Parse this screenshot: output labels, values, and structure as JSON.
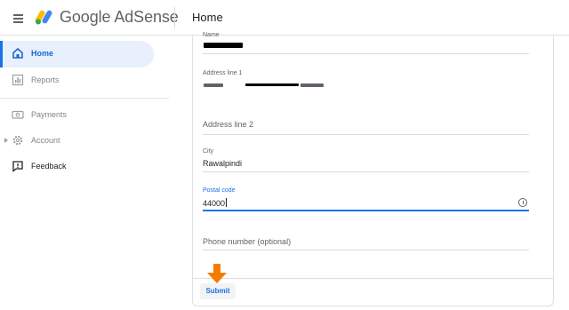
{
  "app": {
    "brand": "Google AdSense",
    "page_title": "Home"
  },
  "sidebar": {
    "items": [
      {
        "label": "Home",
        "icon": "home-icon",
        "active": true
      },
      {
        "label": "Reports",
        "icon": "reports-icon"
      },
      {
        "label": "Payments",
        "icon": "payments-icon"
      },
      {
        "label": "Account",
        "icon": "gear-icon"
      },
      {
        "label": "Feedback",
        "icon": "feedback-icon"
      }
    ]
  },
  "form": {
    "name": {
      "label": "Name",
      "value": ""
    },
    "address1": {
      "label": "Address line 1",
      "value": ""
    },
    "address2": {
      "placeholder": "Address line 2"
    },
    "city": {
      "label": "City",
      "value": "Rawalpindi"
    },
    "postal": {
      "label": "Postal code",
      "value": "44000"
    },
    "phone": {
      "placeholder": "Phone number (optional)"
    },
    "submit_label": "Submit"
  },
  "colors": {
    "accent": "#1a73e8",
    "active_bg": "#e8f0fe",
    "annotation_arrow": "#f57c00"
  }
}
